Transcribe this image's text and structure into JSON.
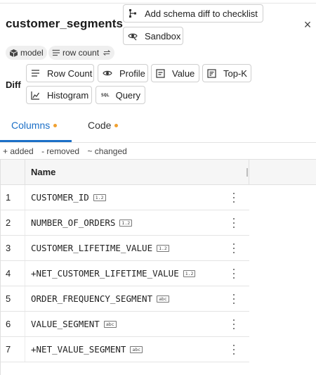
{
  "header": {
    "title": "customer_segments",
    "add_schema_diff_label": "Add schema diff to checklist",
    "sandbox_label": "Sandbox",
    "close_glyph": "×"
  },
  "chips": {
    "model_label": "model",
    "row_count_label": "row count"
  },
  "diff": {
    "label": "Diff",
    "buttons": {
      "row_count": "Row Count",
      "profile": "Profile",
      "value": "Value",
      "top_k": "Top-K",
      "histogram": "Histogram",
      "query": "Query",
      "query_icon_text": "SQL"
    }
  },
  "tabs": {
    "columns": "Columns",
    "code": "Code",
    "active": "columns",
    "dot_color": "#f0a030",
    "accent_color": "#1b6fc7"
  },
  "legend": {
    "added": "+ added",
    "removed": "- removed",
    "changed": "~ changed"
  },
  "table": {
    "header_name": "Name",
    "rows": [
      {
        "index": "1",
        "name": "CUSTOMER_ID",
        "type": "1.2"
      },
      {
        "index": "2",
        "name": "NUMBER_OF_ORDERS",
        "type": "1.2"
      },
      {
        "index": "3",
        "name": "CUSTOMER_LIFETIME_VALUE",
        "type": "1.2"
      },
      {
        "index": "4",
        "name": "+NET_CUSTOMER_LIFETIME_VALUE",
        "type": "1.2"
      },
      {
        "index": "5",
        "name": "ORDER_FREQUENCY_SEGMENT",
        "type": "abc"
      },
      {
        "index": "6",
        "name": "VALUE_SEGMENT",
        "type": "abc"
      },
      {
        "index": "7",
        "name": "+NET_VALUE_SEGMENT",
        "type": "abc"
      }
    ]
  }
}
